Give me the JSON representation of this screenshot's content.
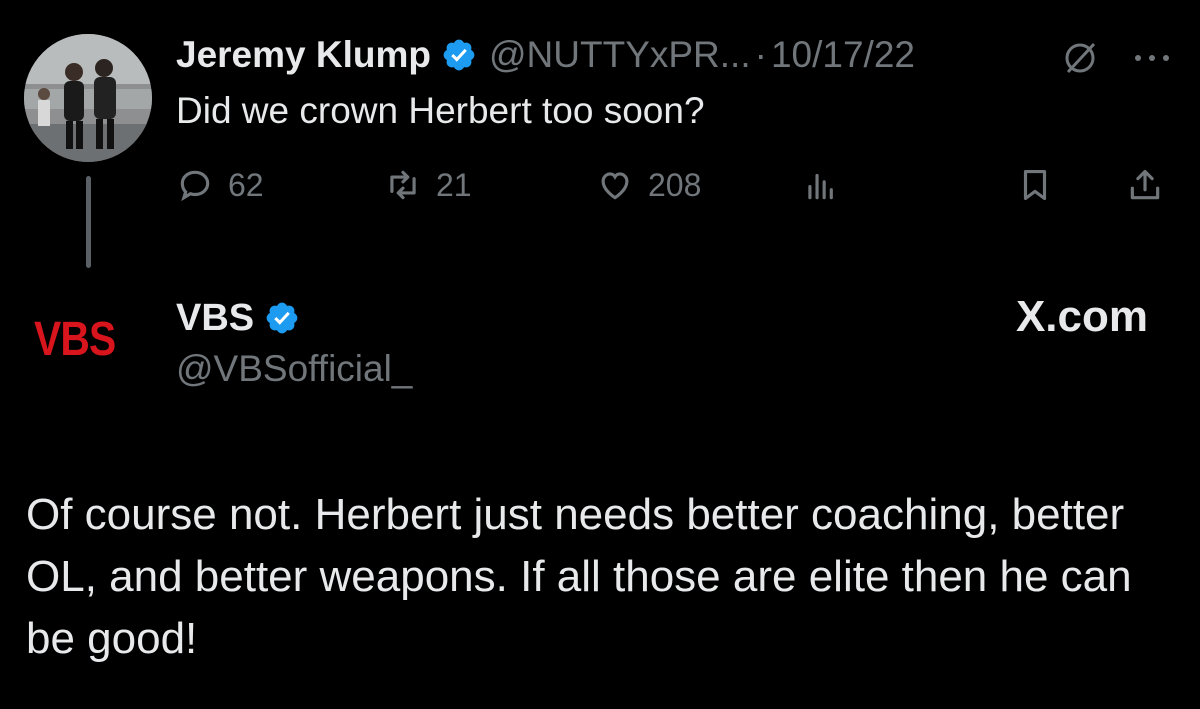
{
  "tweet": {
    "display_name": "Jeremy Klump",
    "handle": "@NUTTYxPR...",
    "separator": "·",
    "date": "10/17/22",
    "text": "Did we crown Herbert too soon?",
    "avatar_icon": "avatar-photo",
    "actions": {
      "replies": "62",
      "retweets": "21",
      "likes": "208"
    }
  },
  "quoted": {
    "logo_text": "VBS",
    "display_name": "VBS",
    "handle": "@VBSofficial_",
    "site_label": "X.com",
    "body": "Of course not. Herbert just needs better coaching, better OL, and better weapons. If all those are elite then he can be good!"
  },
  "colors": {
    "background": "#000000",
    "text": "#e7e9ea",
    "muted": "#71767b",
    "verified": "#1d9bf0",
    "vbs_red": "#d8141c"
  }
}
